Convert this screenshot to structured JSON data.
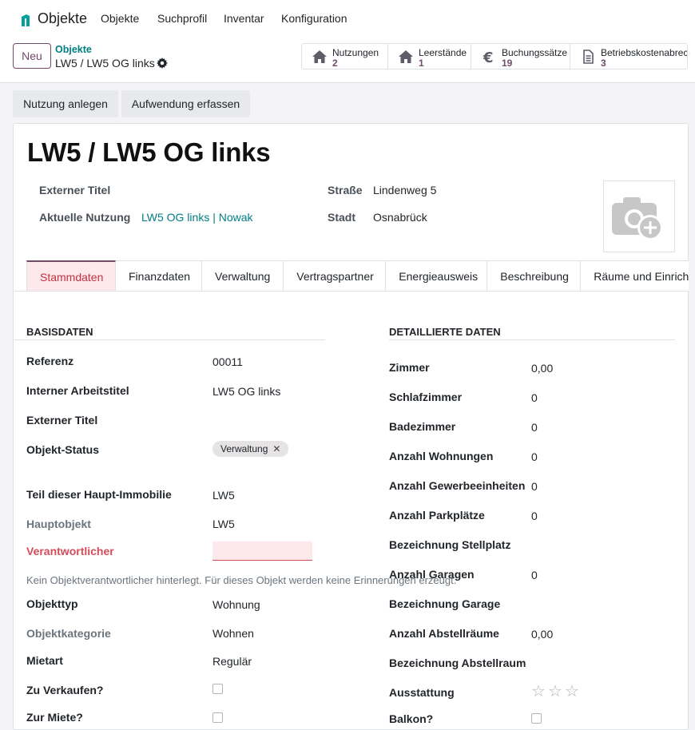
{
  "app": {
    "name": "Objekte"
  },
  "menu": [
    "Objekte",
    "Suchprofil",
    "Inventar",
    "Konfiguration"
  ],
  "control": {
    "new_label": "Neu",
    "breadcrumb_parent": "Objekte",
    "breadcrumb_current": "LW5 / LW5 OG links"
  },
  "smart_buttons": [
    {
      "label": "Nutzungen",
      "count": "2",
      "icon": "home-icon"
    },
    {
      "label": "Leerstände",
      "count": "1",
      "icon": "home-icon"
    },
    {
      "label": "Buchungssätze",
      "count": "19",
      "icon": "euro-icon"
    },
    {
      "label": "Betriebskostenabrechnu",
      "count": "3",
      "icon": "document-icon"
    }
  ],
  "actions": {
    "add_usage": "Nutzung anlegen",
    "add_expense": "Aufwendung erfassen"
  },
  "record": {
    "title": "LW5 / LW5 OG links",
    "external_title_label": "Externer Titel",
    "current_usage_label": "Aktuelle Nutzung",
    "current_usage_value": "LW5 OG links | Nowak",
    "street_label": "Straße",
    "street_value": "Lindenweg 5",
    "city_label": "Stadt",
    "city_value": "Osnabrück"
  },
  "tabs": [
    "Stammdaten",
    "Finanzdaten",
    "Verwaltung",
    "Vertragspartner",
    "Energieausweis",
    "Beschreibung",
    "Räume und Einricht"
  ],
  "basis": {
    "heading": "BASISDATEN",
    "referenz_label": "Referenz",
    "referenz_value": "00011",
    "internal_title_label": "Interner Arbeitstitel",
    "internal_title_value": "LW5 OG links",
    "external_title_label": "Externer Titel",
    "status_label": "Objekt-Status",
    "status_tag": "Verwaltung",
    "tag_remove": "✕",
    "part_of_label": "Teil dieser Haupt-Immobilie",
    "part_of_value": "LW5",
    "main_object_label": "Hauptobjekt",
    "main_object_value": "LW5",
    "responsible_label": "Verantwortlicher",
    "hint": "Kein Objektverantwortlicher hinterlegt. Für dieses Objekt werden keine Erinnerungen erzeugt.",
    "type_label": "Objekttyp",
    "type_value": "Wohnung",
    "category_label": "Objektkategorie",
    "category_value": "Wohnen",
    "rent_type_label": "Mietart",
    "rent_type_value": "Regulär",
    "for_sale_label": "Zu Verkaufen?",
    "for_rent_label": "Zur Miete?"
  },
  "details": {
    "heading": "DETAILLIERTE DATEN",
    "rooms_label": "Zimmer",
    "rooms_value": "0,00",
    "bedrooms_label": "Schlafzimmer",
    "bedrooms_value": "0",
    "bathrooms_label": "Badezimmer",
    "bathrooms_value": "0",
    "apartments_label": "Anzahl Wohnungen",
    "apartments_value": "0",
    "commercial_label": "Anzahl Gewerbeeinheiten",
    "commercial_value": "0",
    "parking_label": "Anzahl Parkplätze",
    "parking_value": "0",
    "parking_name_label": "Bezeichnung Stellplatz",
    "garages_label": "Anzahl Garagen",
    "garages_value": "0",
    "garage_name_label": "Bezeichnung Garage",
    "storage_label": "Anzahl Abstellräume",
    "storage_value": "0,00",
    "storage_name_label": "Bezeichnung Abstellraum",
    "equipment_label": "Ausstattung",
    "equipment_rating": 0,
    "equipment_max": 3,
    "balcony_label": "Balkon?"
  },
  "colors": {
    "accent": "#714b67",
    "link": "#017e84",
    "danger": "#d44c59",
    "logo": "#01a09d"
  }
}
